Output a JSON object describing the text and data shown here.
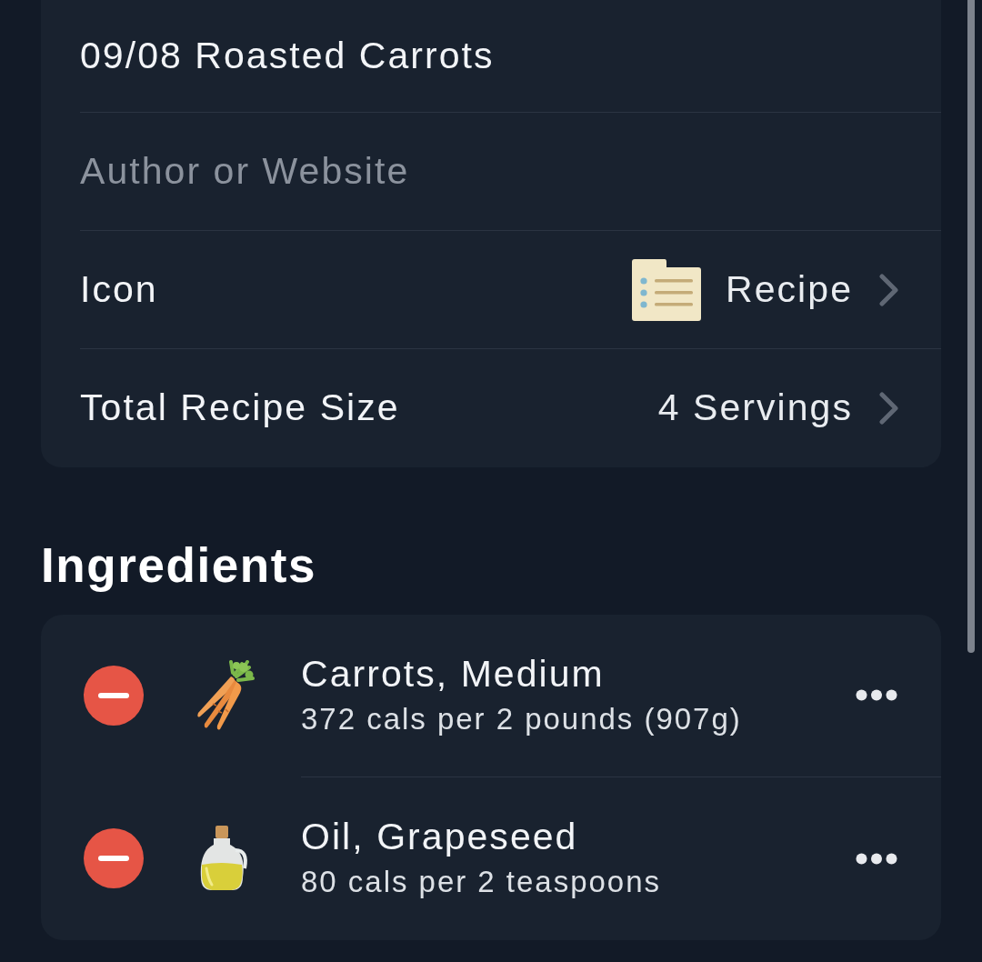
{
  "details": {
    "title_field": {
      "value": "09/08 Roasted Carrots"
    },
    "author_field": {
      "placeholder": "Author or Website"
    },
    "rows": [
      {
        "kind": "icon",
        "label": "Icon",
        "value": "Recipe"
      },
      {
        "kind": "size",
        "label": "Total Recipe Size",
        "value": "4 Servings"
      }
    ]
  },
  "ingredients": {
    "heading": "Ingredients",
    "items": [
      {
        "kind": "carrot",
        "name": "Carrots, Medium",
        "calories": "372 cals per 2 pounds (907g)"
      },
      {
        "kind": "oil",
        "name": "Oil, Grapeseed",
        "calories": "80 cals per 2 teaspoons"
      }
    ]
  }
}
